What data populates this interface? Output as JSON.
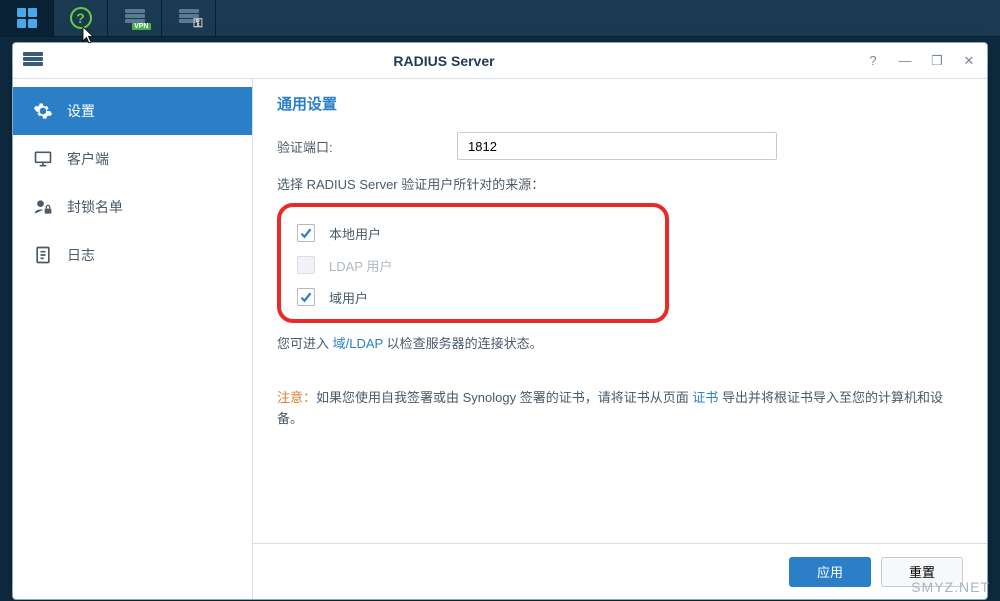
{
  "window": {
    "title": "RADIUS Server",
    "controls": {
      "help": "?",
      "min": "—",
      "max": "❐",
      "close": "✕"
    }
  },
  "sidebar": {
    "items": [
      {
        "id": "settings",
        "label": "设置"
      },
      {
        "id": "clients",
        "label": "客户端"
      },
      {
        "id": "blocklist",
        "label": "封锁名单"
      },
      {
        "id": "logs",
        "label": "日志"
      }
    ],
    "active": "settings"
  },
  "main": {
    "section_title": "通用设置",
    "port_label": "验证端口:",
    "port_value": "1812",
    "source_label": "选择 RADIUS Server 验证用户所针对的来源：",
    "sources": [
      {
        "id": "local",
        "label": "本地用户",
        "checked": true,
        "disabled": false
      },
      {
        "id": "ldap",
        "label": "LDAP 用户",
        "checked": false,
        "disabled": true
      },
      {
        "id": "domain",
        "label": "域用户",
        "checked": true,
        "disabled": false
      }
    ],
    "hint_pre": "您可进入 ",
    "hint_link": "域/LDAP",
    "hint_post": " 以检查服务器的连接状态。",
    "note_label": "注意：",
    "note_pre": "如果您使用自我签署或由 Synology 签署的证书，请将证书从页面 ",
    "note_link": "证书",
    "note_post": " 导出并将根证书导入至您的计算机和设备。"
  },
  "footer": {
    "apply": "应用",
    "reset": "重置"
  },
  "watermark": "SMYZ.NET"
}
